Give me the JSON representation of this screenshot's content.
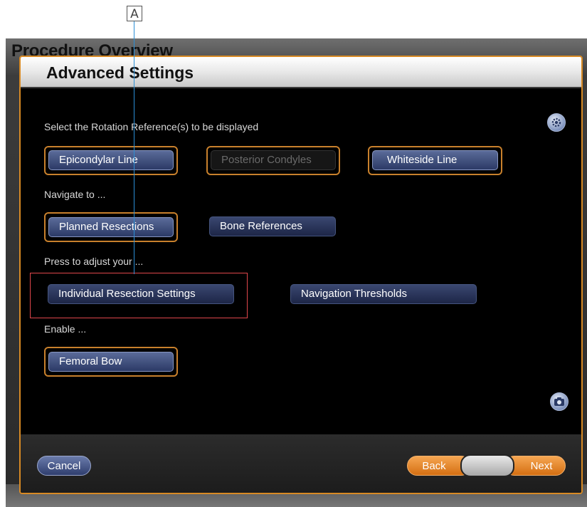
{
  "callout": {
    "letter": "A"
  },
  "background_window": {
    "title": "Procedure Overview"
  },
  "dialog": {
    "title": "Advanced Settings",
    "rotation_prompt": "Select the Rotation Reference(s) to be displayed",
    "rotation_options": [
      {
        "label": "Epicondylar Line",
        "state": "selected"
      },
      {
        "label": "Posterior Condyles",
        "state": "disabled"
      },
      {
        "label": "Whiteside Line",
        "state": "selected"
      }
    ],
    "navigate_prompt": "Navigate to ...",
    "navigate_options": [
      {
        "label": "Planned Resections",
        "state": "selected"
      },
      {
        "label": "Bone References",
        "state": "normal"
      }
    ],
    "adjust_prompt": "Press to adjust your ...",
    "adjust_options": [
      {
        "label": "Individual Resection Settings"
      },
      {
        "label": "Navigation Thresholds"
      }
    ],
    "enable_prompt": "Enable ...",
    "enable_options": [
      {
        "label": "Femoral Bow",
        "state": "selected"
      }
    ],
    "icons": {
      "top_right": "gear-icon",
      "bottom_right": "camera-icon"
    }
  },
  "footer": {
    "cancel_label": "Cancel",
    "back_label": "Back",
    "middle_label": "",
    "next_label": "Next"
  },
  "colors": {
    "accent_orange": "#d88a24",
    "button_blue": "#3a4a7a",
    "highlight_red": "#e0474c",
    "callout_line": "#2b8fd6"
  }
}
